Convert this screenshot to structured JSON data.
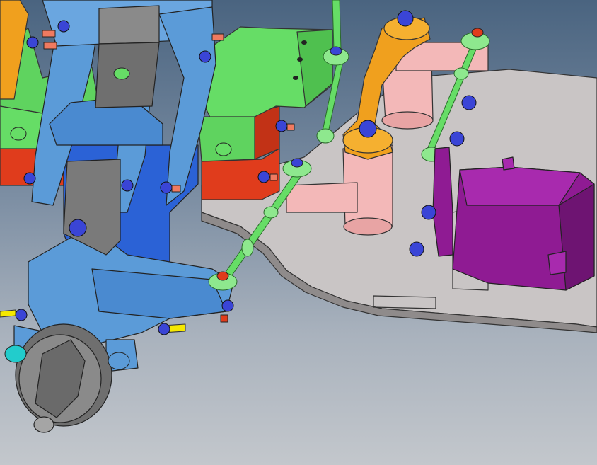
{
  "viewport": {
    "background_top": "#4a6480",
    "background_bottom": "#c3c7cc"
  },
  "model": {
    "parts": [
      {
        "name": "chassis-plate",
        "color": "#c9c5c5"
      },
      {
        "name": "front-frame",
        "color": "#5b9bd8"
      },
      {
        "name": "suspension-arm",
        "color": "#2b62d6"
      },
      {
        "name": "motor-mount",
        "color": "#66dd66"
      },
      {
        "name": "battery-block",
        "color": "#e03c1c"
      },
      {
        "name": "steering-link",
        "color": "#f0a01e"
      },
      {
        "name": "steering-post",
        "color": "#f3b8b8"
      },
      {
        "name": "tie-rod",
        "color": "#66dd66"
      },
      {
        "name": "servo",
        "color": "#8f1b93"
      },
      {
        "name": "servo-horn",
        "color": "#8f1b93"
      },
      {
        "name": "hub",
        "color": "#5b9bd8"
      },
      {
        "name": "wheel-hub",
        "color": "#6f6f6f"
      },
      {
        "name": "nut",
        "color": "#3a45d6"
      },
      {
        "name": "bolt",
        "color": "#f07a60"
      },
      {
        "name": "axle",
        "color": "#f5e800"
      }
    ]
  }
}
